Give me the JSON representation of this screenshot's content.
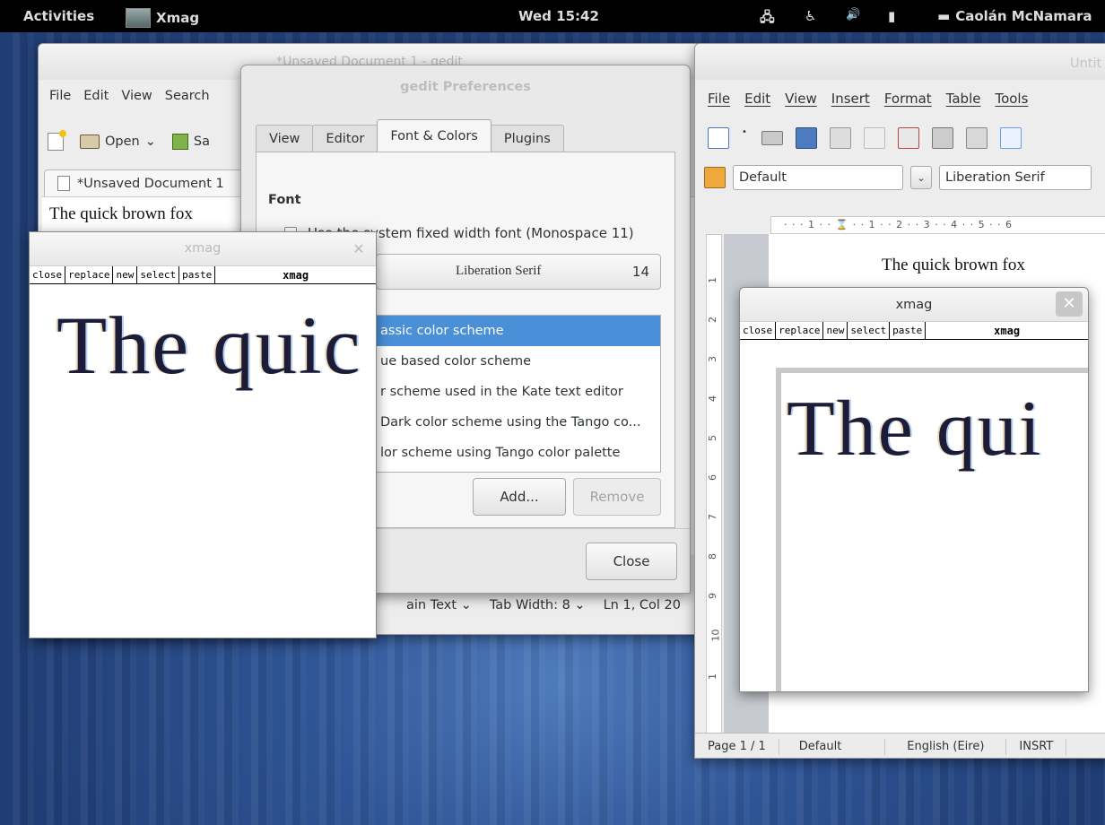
{
  "topbar": {
    "activities": "Activities",
    "app_name": "Xmag",
    "clock": "Wed 15:42",
    "user": "Caolán McNamara"
  },
  "gedit": {
    "title": "*Unsaved Document 1 - gedit",
    "menu": [
      "File",
      "Edit",
      "View",
      "Search"
    ],
    "toolbar": {
      "new_label": "",
      "open_label": "Open",
      "save_label": "Sa"
    },
    "tab_label": "*Unsaved Document 1",
    "text": "The quick brown fox",
    "status": {
      "lang": "ain Text",
      "tab_width": "Tab Width: 8",
      "position": "Ln 1, Col 20"
    }
  },
  "prefs": {
    "title": "gedit Preferences",
    "tabs": [
      "View",
      "Editor",
      "Font & Colors",
      "Plugins"
    ],
    "font_heading": "Font",
    "system_font_label": "Use the system fixed width font (Monospace 11)",
    "font_name": "Liberation Serif",
    "font_size": "14",
    "schemes": [
      "assic color scheme",
      "ue based color scheme",
      "r scheme used in the Kate text editor",
      "Dark color scheme using the Tango co...",
      "lor scheme using Tango color palette"
    ],
    "add_label": "Add...",
    "remove_label": "Remove",
    "close_label": "Close"
  },
  "xmag_left": {
    "title": "xmag",
    "buttons": [
      "close",
      "replace",
      "new",
      "select",
      "paste"
    ],
    "label": "xmag",
    "magnified_text": "The quic"
  },
  "lo": {
    "title": "Untit",
    "menu": [
      "File",
      "Edit",
      "View",
      "Insert",
      "Format",
      "Table",
      "Tools"
    ],
    "style_combo": "Default",
    "font_combo": "Liberation Serif",
    "ruler": "· · · 1 · · ⌛ · · 1 · · 2 · · 3 · · 4 · · 5 · · 6",
    "vruler": [
      "1",
      "2",
      "3",
      "4",
      "5",
      "6",
      "7",
      "8",
      "9",
      "10",
      "1"
    ],
    "page_text": "The quick brown fox",
    "status": {
      "page": "Page 1 / 1",
      "style": "Default",
      "lang": "English (Eire)",
      "mode": "INSRT"
    }
  },
  "xmag_right": {
    "title": "xmag",
    "buttons": [
      "close",
      "replace",
      "new",
      "select",
      "paste"
    ],
    "label": "xmag",
    "magnified_text": "The qui"
  }
}
